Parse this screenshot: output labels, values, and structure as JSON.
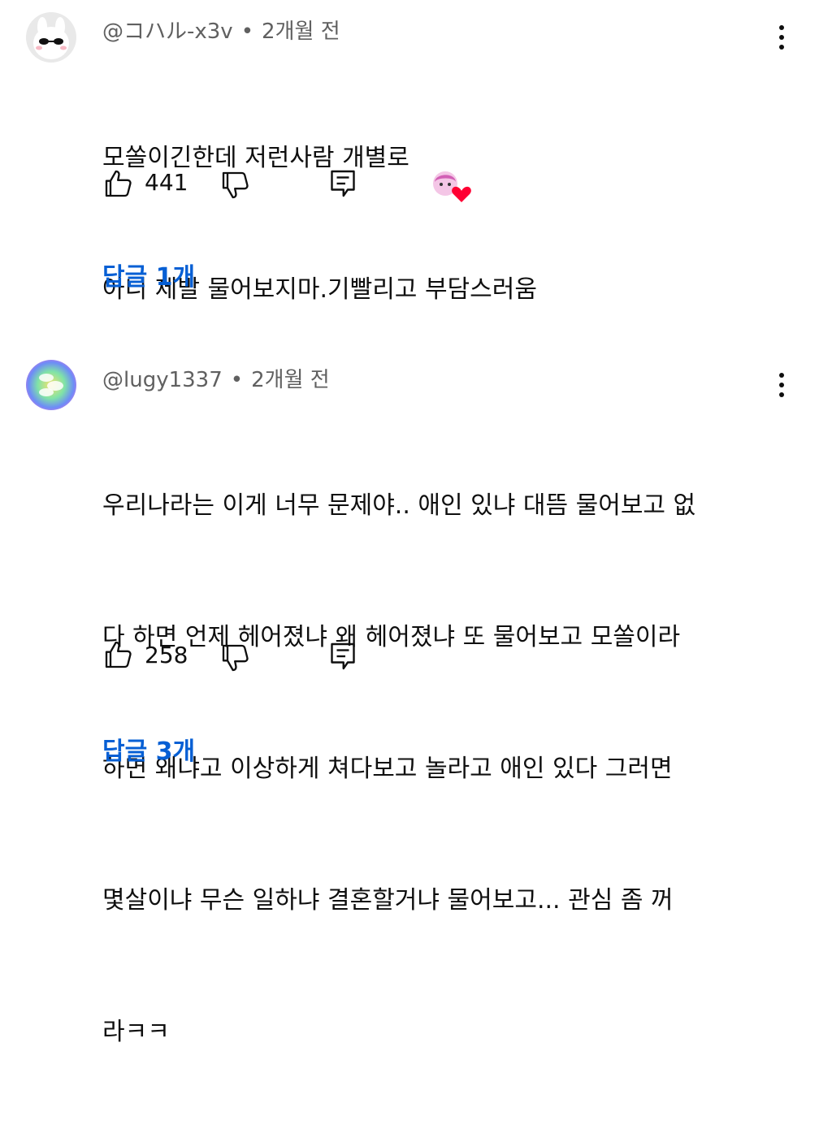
{
  "comments": [
    {
      "handle": "@コハル-x3v",
      "separator": "•",
      "time": "2개월 전",
      "lines": [
        "모쏠이긴한데 저런사람 개별로",
        "아니 제발 물어보지마.기빨리고 부담스러움"
      ],
      "likes": "441",
      "creator_heart": true,
      "replies_label": "답글 1개"
    },
    {
      "handle": "@lugy1337",
      "separator": "•",
      "time": "2개월 전",
      "lines": [
        "우리나라는 이게 너무 문제야.. 애인 있냐 대뜸 물어보고 없",
        "다 하면 언제 헤어졌냐 왜 헤어졌냐 또 물어보고 모쏠이라",
        "하면 왜냐고 이상하게 쳐다보고 놀라고 애인 있다 그러면",
        "몇살이냐 무슨 일하냐 결혼할거냐 물어보고... 관심 좀 꺼",
        "라ㅋㅋ"
      ],
      "likes": "258",
      "creator_heart": false,
      "replies_label": "답글 3개"
    }
  ],
  "icons": {
    "like": "thumbs-up-icon",
    "dislike": "thumbs-down-icon",
    "reply": "reply-icon",
    "more": "more-vert-icon",
    "heart": "creator-heart-icon"
  },
  "colors": {
    "link": "#065fd4",
    "meta": "#606060",
    "text": "#0f0f0f",
    "heart": "#ff0033"
  }
}
